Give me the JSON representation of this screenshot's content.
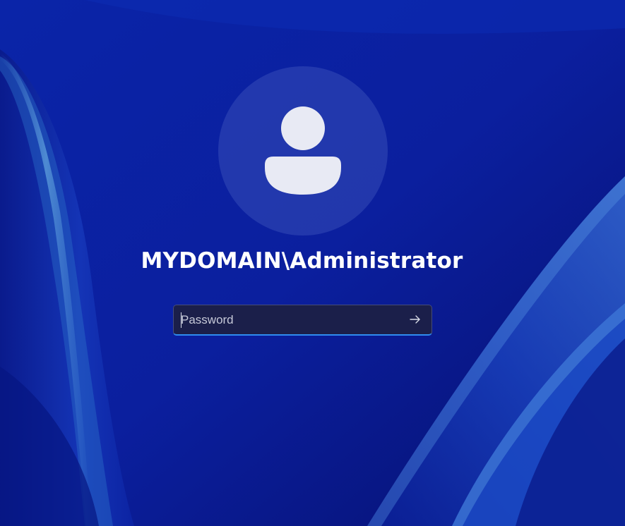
{
  "login": {
    "username": "MYDOMAIN\\Administrator",
    "password_placeholder": "Password",
    "password_value": ""
  },
  "icons": {
    "avatar": "user-icon",
    "submit": "arrow-right-icon"
  },
  "colors": {
    "background": "#0a1fa0",
    "accent": "#2f8cf0",
    "text": "#ffffff"
  }
}
